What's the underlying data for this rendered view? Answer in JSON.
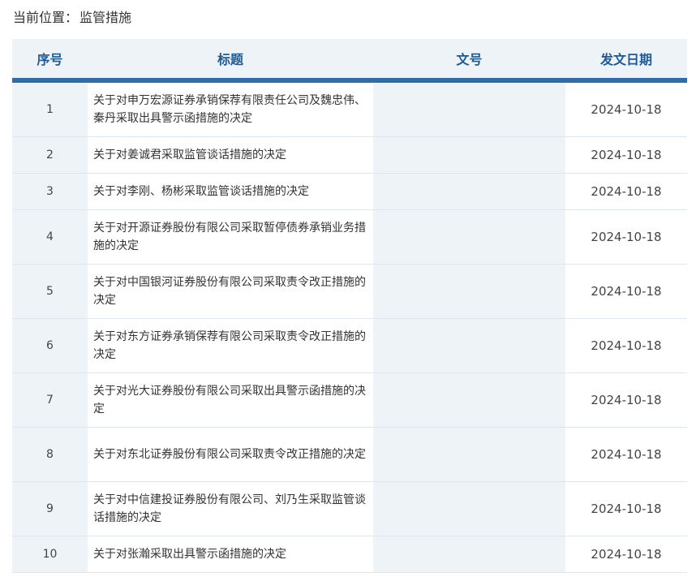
{
  "breadcrumb": {
    "prefix": "当前位置：",
    "current": "监管措施"
  },
  "table": {
    "headers": {
      "index": "序号",
      "title": "标题",
      "doc_no": "文号",
      "date": "发文日期"
    },
    "rows": [
      {
        "index": "1",
        "title": "关于对申万宏源证券承销保荐有限责任公司及魏忠伟、秦丹采取出具警示函措施的决定",
        "doc_no": "",
        "date": "2024-10-18"
      },
      {
        "index": "2",
        "title": "关于对姜诚君采取监管谈话措施的决定",
        "doc_no": "",
        "date": "2024-10-18"
      },
      {
        "index": "3",
        "title": "关于对李刚、杨彬采取监管谈话措施的决定",
        "doc_no": "",
        "date": "2024-10-18"
      },
      {
        "index": "4",
        "title": "关于对开源证券股份有限公司采取暂停债券承销业务措施的决定",
        "doc_no": "",
        "date": "2024-10-18"
      },
      {
        "index": "5",
        "title": "关于对中国银河证券股份有限公司采取责令改正措施的决定",
        "doc_no": "",
        "date": "2024-10-18"
      },
      {
        "index": "6",
        "title": "关于对东方证券承销保荐有限公司采取责令改正措施的决定",
        "doc_no": "",
        "date": "2024-10-18"
      },
      {
        "index": "7",
        "title": "关于对光大证券股份有限公司采取出具警示函措施的决定",
        "doc_no": "",
        "date": "2024-10-18"
      },
      {
        "index": "8",
        "title": "关于对东北证券股份有限公司采取责令改正措施的决定",
        "doc_no": "",
        "date": "2024-10-18"
      },
      {
        "index": "9",
        "title": "关于对中信建投证券股份有限公司、刘乃生采取监管谈话措施的决定",
        "doc_no": "",
        "date": "2024-10-18"
      },
      {
        "index": "10",
        "title": "关于对张瀚采取出具警示函措施的决定",
        "doc_no": "",
        "date": "2024-10-18"
      }
    ]
  }
}
